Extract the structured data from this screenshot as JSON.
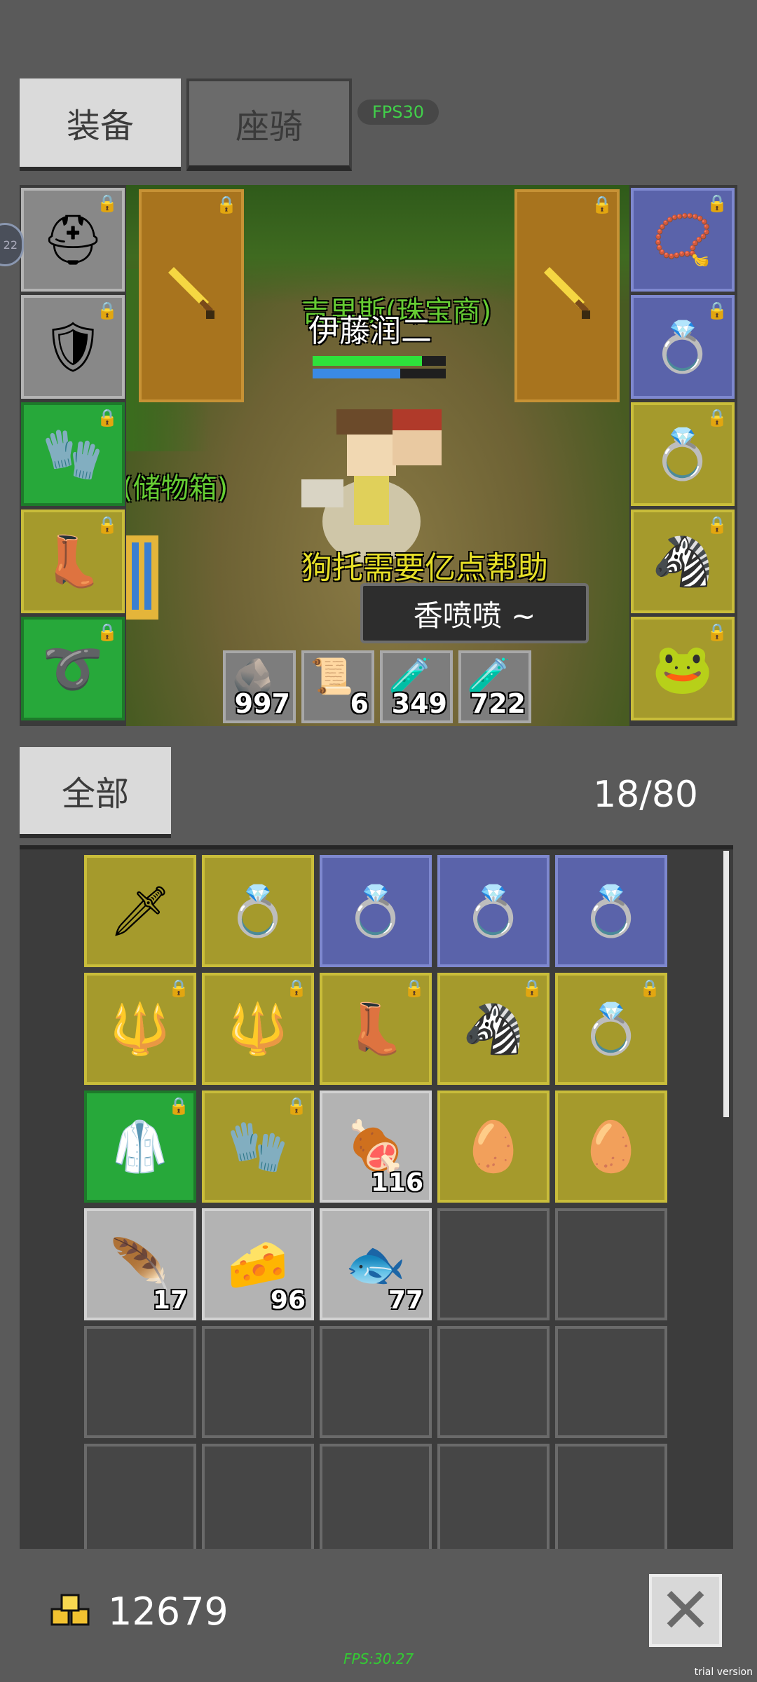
{
  "tabs": {
    "equip": "装备",
    "mount": "座骑"
  },
  "fps_pill": "FPS30",
  "side_badge": "22",
  "scene": {
    "player_name": "伊藤润二",
    "npc_name": "吉里斯(珠宝商)",
    "left_label": "(储物箱)",
    "shout": "狗托需要亿点帮助",
    "bubble": "香喷喷 ~",
    "hp_fraction": 0.82,
    "mp_fraction": 0.66
  },
  "quick_slots": [
    {
      "icon": "ore-icon",
      "qty": "997"
    },
    {
      "icon": "scroll-icon",
      "qty": "6"
    },
    {
      "icon": "red-potion-icon",
      "qty": "349"
    },
    {
      "icon": "blue-potion-icon",
      "qty": "722"
    }
  ],
  "equipment_left": [
    {
      "slot": "helmet",
      "icon": "horned-helmet-icon",
      "color": "gray"
    },
    {
      "slot": "armor",
      "icon": "chainmail-icon",
      "color": "gray"
    },
    {
      "slot": "gloves",
      "icon": "red-glove-icon",
      "color": "green"
    },
    {
      "slot": "boots",
      "icon": "boots-icon",
      "color": "yellow"
    },
    {
      "slot": "belt",
      "icon": "belt-icon",
      "color": "green"
    }
  ],
  "equipment_right": [
    {
      "slot": "necklace",
      "icon": "necklace-icon",
      "color": "blue"
    },
    {
      "slot": "ring-1",
      "icon": "ring-icon",
      "color": "blue"
    },
    {
      "slot": "ring-2",
      "icon": "sapphire-ring-icon",
      "color": "yellow"
    },
    {
      "slot": "pet",
      "icon": "zebra-head-icon",
      "color": "yellow"
    },
    {
      "slot": "companion",
      "icon": "frog-pet-icon",
      "color": "yellow"
    }
  ],
  "weapon_slots": [
    {
      "icon": "golden-sword-icon"
    },
    {
      "icon": "golden-sword-icon"
    }
  ],
  "inventory": {
    "filter": "全部",
    "capacity": "18/80",
    "rows": [
      [
        {
          "icon": "greatsword-icon",
          "color": "yellow",
          "lock": false,
          "qty": ""
        },
        {
          "icon": "ring-icon",
          "color": "yellow",
          "lock": false,
          "qty": ""
        },
        {
          "icon": "ring-icon",
          "color": "blue",
          "lock": false,
          "qty": ""
        },
        {
          "icon": "ring-icon",
          "color": "blue",
          "lock": false,
          "qty": ""
        },
        {
          "icon": "ring-icon",
          "color": "blue",
          "lock": false,
          "qty": ""
        }
      ],
      [
        {
          "icon": "spear-icon",
          "color": "yellow",
          "lock": true,
          "qty": ""
        },
        {
          "icon": "spear-icon",
          "color": "yellow",
          "lock": true,
          "qty": ""
        },
        {
          "icon": "boots-icon",
          "color": "yellow",
          "lock": true,
          "qty": ""
        },
        {
          "icon": "zebra-head-icon",
          "color": "yellow",
          "lock": true,
          "qty": ""
        },
        {
          "icon": "amethyst-ring-icon",
          "color": "yellow",
          "lock": true,
          "qty": ""
        }
      ],
      [
        {
          "icon": "blue-armor-icon",
          "color": "green",
          "lock": true,
          "qty": ""
        },
        {
          "icon": "gauntlet-icon",
          "color": "yellow",
          "lock": true,
          "qty": ""
        },
        {
          "icon": "meat-icon",
          "color": "gray",
          "lock": false,
          "qty": "116"
        },
        {
          "icon": "egg-icon",
          "color": "yellow",
          "lock": false,
          "qty": ""
        },
        {
          "icon": "egg-icon",
          "color": "yellow",
          "lock": false,
          "qty": ""
        }
      ],
      [
        {
          "icon": "feather-icon",
          "color": "gray",
          "lock": false,
          "qty": "17"
        },
        {
          "icon": "gold-nugget-icon",
          "color": "gray",
          "lock": false,
          "qty": "96"
        },
        {
          "icon": "fish-icon",
          "color": "gray",
          "lock": false,
          "qty": "77"
        },
        {
          "icon": "",
          "color": "empty",
          "lock": false,
          "qty": ""
        },
        {
          "icon": "",
          "color": "empty",
          "lock": false,
          "qty": ""
        }
      ],
      [
        {
          "icon": "",
          "color": "empty",
          "lock": false,
          "qty": ""
        },
        {
          "icon": "",
          "color": "empty",
          "lock": false,
          "qty": ""
        },
        {
          "icon": "",
          "color": "empty",
          "lock": false,
          "qty": ""
        },
        {
          "icon": "",
          "color": "empty",
          "lock": false,
          "qty": ""
        },
        {
          "icon": "",
          "color": "empty",
          "lock": false,
          "qty": ""
        }
      ],
      [
        {
          "icon": "",
          "color": "empty",
          "lock": false,
          "qty": ""
        },
        {
          "icon": "",
          "color": "empty",
          "lock": false,
          "qty": ""
        },
        {
          "icon": "",
          "color": "empty",
          "lock": false,
          "qty": ""
        },
        {
          "icon": "",
          "color": "empty",
          "lock": false,
          "qty": ""
        },
        {
          "icon": "",
          "color": "empty",
          "lock": false,
          "qty": ""
        }
      ]
    ]
  },
  "gold": "12679",
  "fps_bottom": "FPS:30.27",
  "trial": "trial version"
}
